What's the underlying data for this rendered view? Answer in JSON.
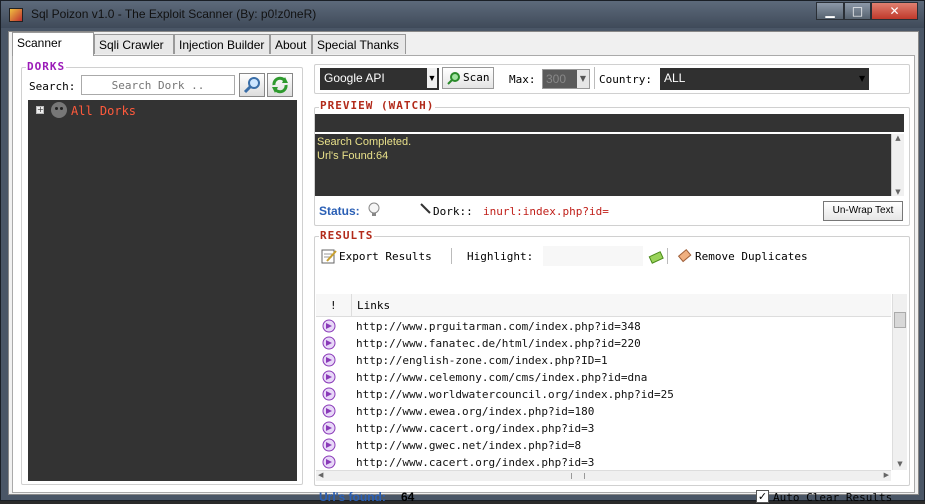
{
  "window": {
    "title": "Sql Poizon v1.0 - The Exploit Scanner (By: p0!z0neR)"
  },
  "tabs": [
    {
      "label": "Scanner",
      "active": true
    },
    {
      "label": "Sqli Crawler"
    },
    {
      "label": "Injection Builder"
    },
    {
      "label": "About"
    },
    {
      "label": "Special Thanks"
    }
  ],
  "dorks": {
    "group_label": "DORKS",
    "search_label": "Search:",
    "search_placeholder": "Search Dork ..",
    "tree_root_label": "All Dorks"
  },
  "toolbar": {
    "engine_value": "Google API",
    "scan_label": "Scan",
    "max_label": "Max:",
    "max_value": "300",
    "country_label": "Country:",
    "country_value": "ALL"
  },
  "preview": {
    "group_label": "PREVIEW (WATCH)",
    "log_line1": "Search Completed.",
    "log_line2": "Url's Found:64",
    "status_label": "Status:",
    "dork_label": "Dork::",
    "dork_value": "inurl:index.php?id=",
    "unwrap_label": "Un-Wrap Text"
  },
  "results": {
    "group_label": "RESULTS",
    "export_label": "Export Results",
    "highlight_label": "Highlight:",
    "remove_dupes_label": "Remove Duplicates",
    "col_flag": "!",
    "col_links": "Links",
    "rows": [
      "http://www.prguitarman.com/index.php?id=348",
      "http://www.fanatec.de/html/index.php?id=220",
      "http://english-zone.com/index.php?ID=1",
      "http://www.celemony.com/cms/index.php?id=dna",
      "http://www.worldwatercouncil.org/index.php?id=25",
      "http://www.ewea.org/index.php?id=180",
      "http://www.cacert.org/index.php?id=3",
      "http://www.gwec.net/index.php?id=8",
      "http://www.cacert.org/index.php?id=3"
    ],
    "found_label": "Url's found:",
    "found_value": "64",
    "auto_clear_label": "Auto Clear Results",
    "auto_clear_checked": true
  },
  "colors": {
    "accent_purple": "#9b1bb8",
    "accent_red": "#b22a1a",
    "status_blue": "#2a5fb5",
    "dark_panel": "#333333"
  }
}
